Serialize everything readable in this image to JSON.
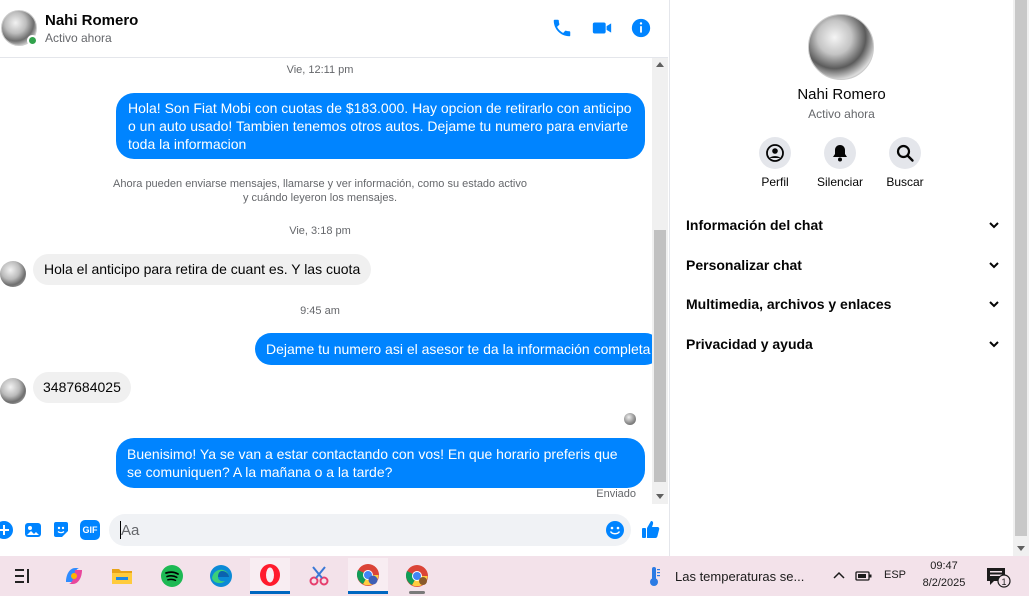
{
  "header": {
    "name": "Nahi Romero",
    "status": "Activo ahora",
    "icons": [
      "phone-icon",
      "video-camera-icon",
      "info-icon"
    ],
    "accent_color": "#0084ff"
  },
  "messages": {
    "timestamps": [
      "Vie, 12:11 pm",
      "Vie, 3:18 pm",
      "9:45 am"
    ],
    "system_note_line1": "Ahora pueden enviarse mensajes, llamarse y ver información, como su estado activo",
    "system_note_line2": "y cuándo leyeron los mensajes.",
    "items": [
      {
        "direction": "outgoing",
        "text": "Hola! Son Fiat Mobi con cuotas de $183.000. Hay opcion de retirarlo con anticipo o un auto usado! Tambien tenemos otros autos. Dejame tu numero para enviarte toda la informacion"
      },
      {
        "direction": "incoming",
        "text": "Hola  el anticipo para retira de cuant es. Y las cuota"
      },
      {
        "direction": "outgoing",
        "text": "Dejame tu numero asi el asesor te da la información completa"
      },
      {
        "direction": "incoming",
        "text": "3487684025"
      },
      {
        "direction": "outgoing",
        "text": "Buenisimo! Ya se van a estar contactando con vos! En que horario preferis que se comuniquen? A la mañana o a la tarde?"
      }
    ],
    "sent_status": "Enviado"
  },
  "composer": {
    "placeholder": "Aa",
    "icons": [
      "plus-icon",
      "image-icon",
      "sticker-icon",
      "gif-icon",
      "emoji-icon",
      "like-icon"
    ],
    "gif_label": "GIF"
  },
  "info_panel": {
    "name": "Nahi Romero",
    "status": "Activo ahora",
    "actions": [
      {
        "label": "Perfil",
        "icon": "profile-icon"
      },
      {
        "label": "Silenciar",
        "icon": "bell-icon"
      },
      {
        "label": "Buscar",
        "icon": "search-icon"
      }
    ],
    "sections": [
      {
        "label": "Información del chat"
      },
      {
        "label": "Personalizar chat"
      },
      {
        "label": "Multimedia, archivos y enlaces"
      },
      {
        "label": "Privacidad y ayuda"
      }
    ]
  },
  "taskbar": {
    "apps": [
      "task-view-icon",
      "copilot-icon",
      "file-explorer-icon",
      "spotify-icon",
      "edge-icon",
      "opera-icon",
      "snipping-tool-icon",
      "chrome-icon",
      "chrome-profile-icon"
    ],
    "weather_text": "Las temperaturas se...",
    "language": "ESP",
    "time": "09:47",
    "date": "8/2/2025",
    "notification_count": "1"
  }
}
